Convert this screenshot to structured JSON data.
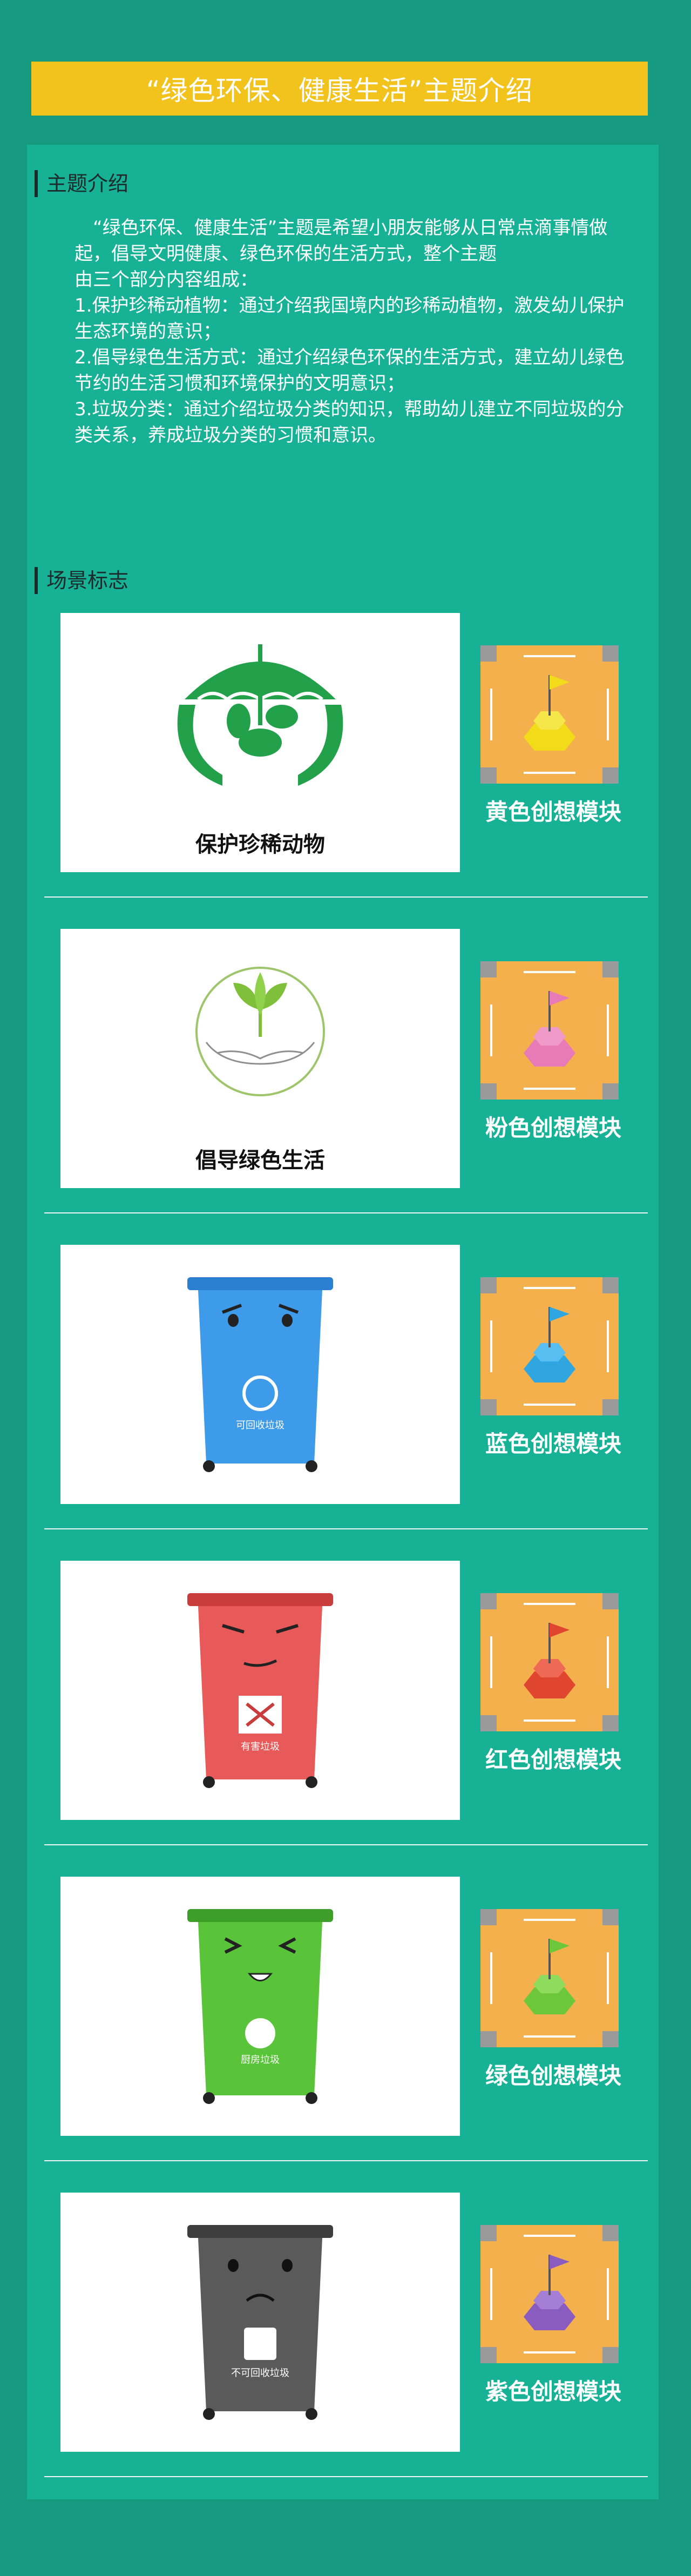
{
  "title": "“绿色环保、健康生活”主题介绍",
  "intro": {
    "heading": "主题介绍",
    "paragraph_1": "“绿色环保、健康生活”主题是希望小朋友能够从日常点滴事情做起，倡导文明健康、绿色环保的生活方式，整个主题",
    "paragraph_2": "由三个部分内容组成：",
    "item_1": "1.保护珍稀动植物：通过介绍我国境内的珍稀动植物，激发幼儿保护生态环境的意识；",
    "item_2": "2.倡导绿色生活方式：通过介绍绿色环保的生活方式，建立幼儿绿色节约的生活习惯和环境保护的文明意识；",
    "item_3": "3.垃圾分类：通过介绍垃圾分类的知识，帮助幼儿建立不同垃圾的分类关系，养成垃圾分类的习惯和意识。"
  },
  "scenes": {
    "heading": "场景标志",
    "rows": [
      {
        "card_label": "保护珍稀动物",
        "module_label": "黄色创想模块",
        "module_color": "#f2dc1a"
      },
      {
        "card_label": "倡导绿色生活",
        "module_label": "粉色创想模块",
        "module_color": "#e87ab8"
      },
      {
        "card_label": "",
        "module_label": "蓝色创想模块",
        "module_color": "#2fa6e0",
        "bin_text": "可回收垃圾"
      },
      {
        "card_label": "",
        "module_label": "红色创想模块",
        "module_color": "#e0452f",
        "bin_text": "有害垃圾"
      },
      {
        "card_label": "",
        "module_label": "绿色创想模块",
        "module_color": "#6cc83a",
        "bin_text": "厨房垃圾"
      },
      {
        "card_label": "",
        "module_label": "紫色创想模块",
        "module_color": "#8a5cc0",
        "bin_text": "不可回收垃圾"
      }
    ]
  },
  "colors": {
    "background": "#159a80",
    "panel": "#17b196",
    "banner": "#f2c21d",
    "bin_blue": "#3d9be9",
    "bin_red": "#e85a5a",
    "bin_green": "#59c43a",
    "bin_gray": "#5a5a5a"
  }
}
